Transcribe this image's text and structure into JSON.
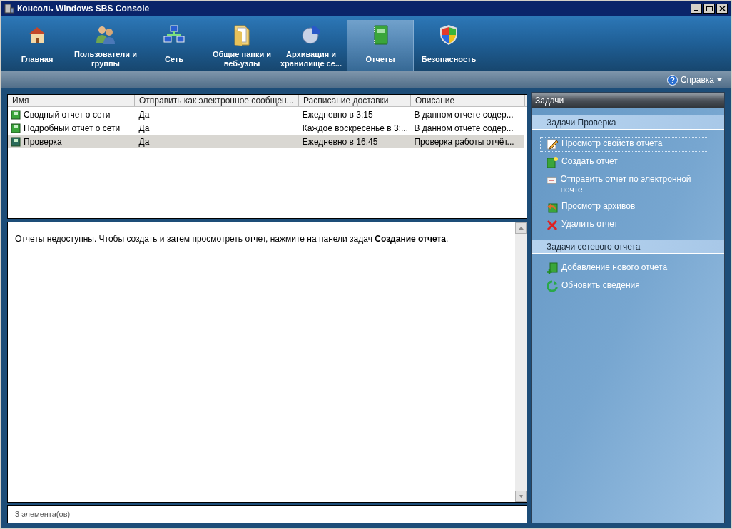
{
  "window": {
    "title": "Консоль Windows SBS Console"
  },
  "tabs": [
    {
      "label": "Главная",
      "kind": "house",
      "selected": false
    },
    {
      "label": "Пользователи и группы",
      "kind": "users",
      "selected": false
    },
    {
      "label": "Сеть",
      "kind": "network",
      "selected": false
    },
    {
      "label": "Общие папки и веб-узлы",
      "kind": "folder",
      "selected": false
    },
    {
      "label": "Архивация и хранилище се...",
      "kind": "pie",
      "selected": false
    },
    {
      "label": "Отчеты",
      "kind": "book",
      "selected": true
    },
    {
      "label": "Безопасность",
      "kind": "shield",
      "selected": false
    }
  ],
  "help": {
    "label": "Справка"
  },
  "table": {
    "columns": [
      "Имя",
      "Отправить как электронное сообщен...",
      "Расписание доставки",
      "Описание"
    ],
    "rows": [
      {
        "cells": [
          "Сводный отчет о сети",
          "Да",
          "Ежедневно в 3:15",
          "В данном отчете содер..."
        ],
        "selected": false
      },
      {
        "cells": [
          "Подробный отчет о сети",
          "Да",
          "Каждое воскресенье в 3:...",
          "В данном отчете содер..."
        ],
        "selected": false
      },
      {
        "cells": [
          "Проверка",
          "Да",
          "Ежедневно в 16:45",
          "Проверка работы отчёт..."
        ],
        "selected": true
      }
    ]
  },
  "details": {
    "message": "Отчеты недоступны. Чтобы создать и затем просмотреть отчет, нажмите на панели задач **Создание отчета**."
  },
  "status_bar": "3 элемента(ов)",
  "tasks": {
    "title": "Задачи",
    "groups": [
      {
        "title": "Задачи Проверка",
        "items": [
          {
            "label": "Просмотр свойств отчета",
            "kind": "pencil",
            "focused": true
          },
          {
            "label": "Создать отчет",
            "kind": "create",
            "focused": false
          },
          {
            "label": "Отправить отчет по электронной почте",
            "kind": "mail",
            "focused": false
          },
          {
            "label": "Просмотр архивов",
            "kind": "archive",
            "focused": false
          },
          {
            "label": "Удалить отчет",
            "kind": "delete",
            "focused": false
          }
        ]
      },
      {
        "title": "Задачи сетевого отчета",
        "items": [
          {
            "label": "Добавление нового отчета",
            "kind": "add",
            "focused": false
          },
          {
            "label": "Обновить сведения",
            "kind": "refresh",
            "focused": false
          }
        ]
      }
    ]
  }
}
